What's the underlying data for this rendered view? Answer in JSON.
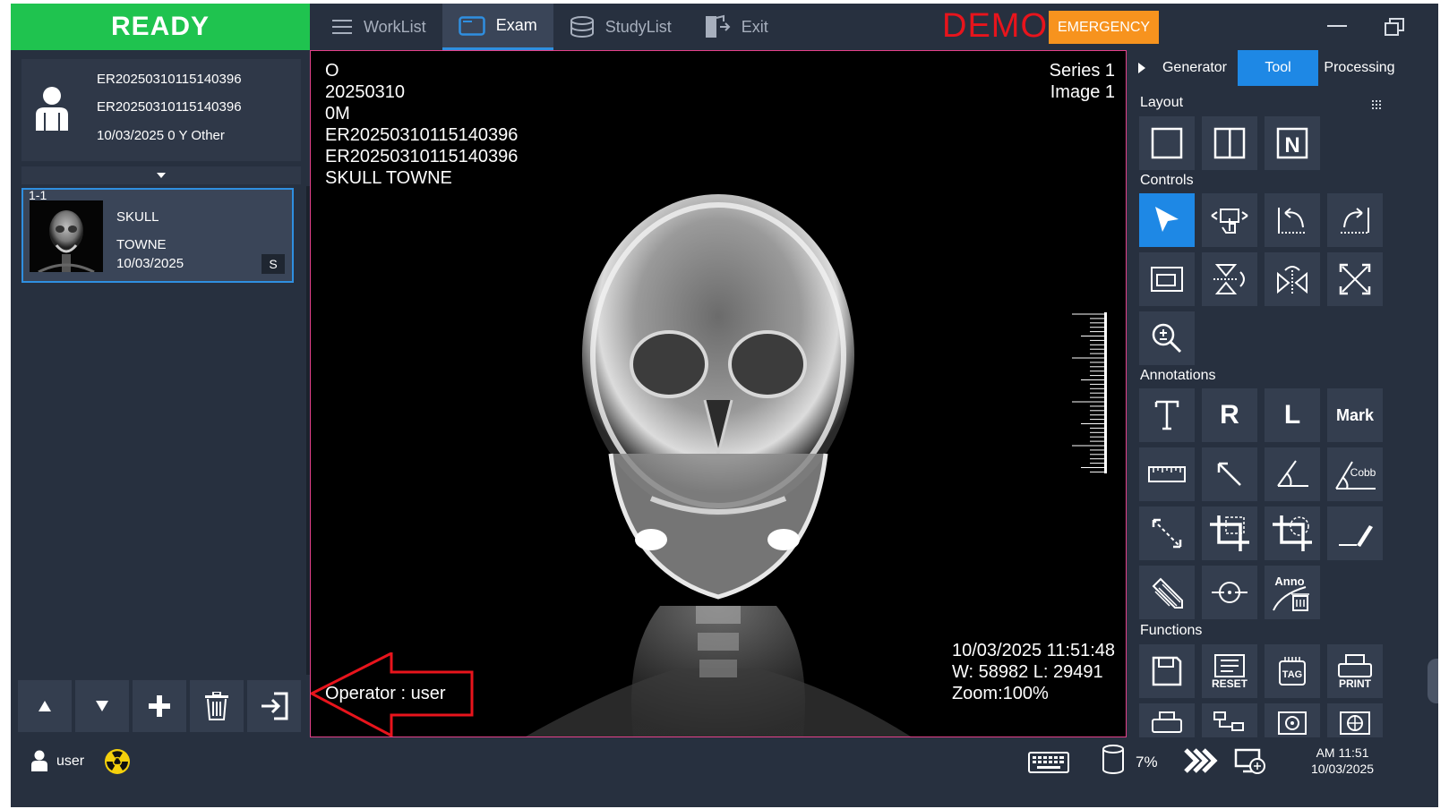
{
  "status": {
    "label": "READY",
    "color": "#1fc34f"
  },
  "nav": {
    "items": [
      {
        "label": "WorkList",
        "icon": "menu-icon",
        "active": false
      },
      {
        "label": "Exam",
        "icon": "monitor-icon",
        "active": true
      },
      {
        "label": "StudyList",
        "icon": "database-icon",
        "active": false
      },
      {
        "label": "Exit",
        "icon": "exit-door-icon",
        "active": false
      }
    ]
  },
  "header": {
    "demo_label": "DEMO",
    "emergency_label": "EMERGENCY"
  },
  "patient": {
    "id": "ER20250310115140396",
    "accession": "ER20250310115140396",
    "info": "10/03/2025 0 Y Other"
  },
  "study_list": {
    "items": [
      {
        "index": "1-1",
        "body_part": "SKULL",
        "view": "TOWNE",
        "date": "10/03/2025",
        "badge": "S"
      }
    ]
  },
  "viewer": {
    "overlay_top_left": [
      "O",
      "20250310",
      "0M",
      "ER20250310115140396",
      "ER20250310115140396",
      "SKULL TOWNE"
    ],
    "series": "Series 1",
    "image": "Image 1",
    "datetime": "10/03/2025 11:51:48",
    "window_level": "W: 58982 L: 29491",
    "zoom": "Zoom:100%",
    "operator": "Operator : user"
  },
  "right_panel": {
    "tabs": [
      {
        "label": "Generator",
        "active": false
      },
      {
        "label": "Tool",
        "active": true
      },
      {
        "label": "Processing",
        "active": false
      }
    ],
    "sections": {
      "layout": "Layout",
      "controls": "Controls",
      "annotations": "Annotations",
      "functions": "Functions"
    },
    "annotation_labels": {
      "text_r": "R",
      "text_l": "L",
      "mark": "Mark",
      "cobb": "Cobb",
      "anno": "Anno"
    },
    "function_labels": {
      "reset": "RESET",
      "tag": "TAG",
      "print": "PRINT"
    },
    "layout_n": "N"
  },
  "footer": {
    "user": "user",
    "disk_usage": "7%",
    "time": "AM 11:51",
    "date": "10/03/2025"
  },
  "colors": {
    "accent": "#1e88e5",
    "emergency": "#f7931e",
    "demo": "#e8141c",
    "panel": "#27303f"
  }
}
